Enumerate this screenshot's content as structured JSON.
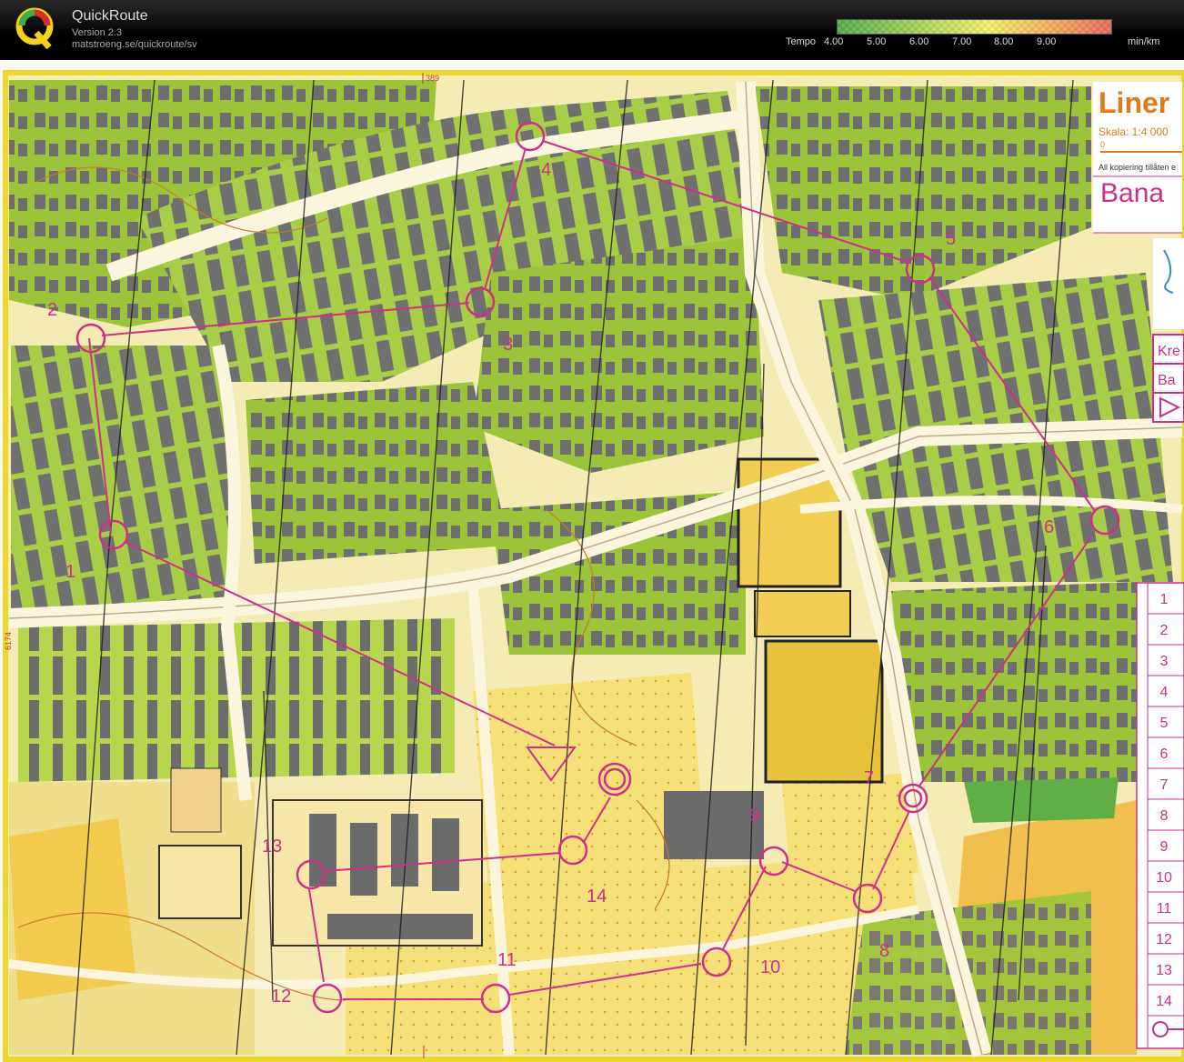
{
  "app": {
    "title": "QuickRoute",
    "version": "Version 2.3",
    "url": "matstroeng.se/quickroute/sv"
  },
  "legend": {
    "prefix": "Tempo",
    "ticks": [
      "4.00",
      "5.00",
      "6.00",
      "7.00",
      "8.00",
      "9.00"
    ],
    "unit": "min/km",
    "colors": [
      "#3ea53a",
      "#a0cf4a",
      "#f2f05a",
      "#f3a04a",
      "#e8584a"
    ]
  },
  "map": {
    "title_fragment": "Liner",
    "scale_text": "Skala: 1:4 000",
    "scale_zero": "0",
    "copyright_fragment": "All kopiering tillåten e",
    "course_fragment": "Bana",
    "grid_labels": [
      "389",
      "6174"
    ],
    "side_box_text": [
      "Kre",
      "Ba"
    ],
    "control_numbers": [
      "1",
      "2",
      "3",
      "4",
      "5",
      "6",
      "7",
      "8",
      "9",
      "10",
      "11",
      "12",
      "13",
      "14"
    ],
    "course_line_color": "#d02e8a",
    "control_labels": [
      "1",
      "2",
      "3",
      "4",
      "5",
      "6",
      "7",
      "8",
      "9",
      "10",
      "11",
      "12",
      "13",
      "14"
    ]
  }
}
